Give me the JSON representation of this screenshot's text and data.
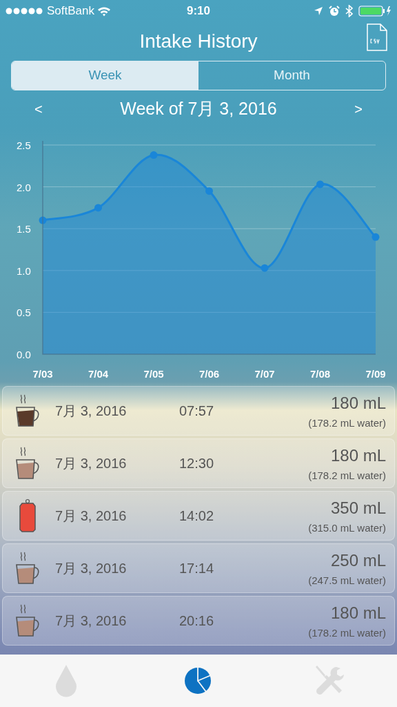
{
  "status_bar": {
    "carrier": "SoftBank",
    "time": "9:10"
  },
  "title": "Intake History",
  "segments": [
    {
      "label": "Week",
      "selected": true
    },
    {
      "label": "Month",
      "selected": false
    }
  ],
  "week_nav": {
    "prev": "<",
    "label": "Week of 7月 3, 2016",
    "next": ">"
  },
  "chart_data": {
    "type": "area",
    "categories": [
      "7/03",
      "7/04",
      "7/05",
      "7/06",
      "7/07",
      "7/08",
      "7/09"
    ],
    "grid": true,
    "series": [
      {
        "color": "#1a86d8",
        "values": [
          1.6,
          1.75,
          2.38,
          1.95,
          1.03,
          2.03,
          1.4
        ]
      }
    ],
    "ylim": [
      0,
      2.5
    ],
    "yticks": [
      {
        "value": 0,
        "label": "0.0"
      },
      {
        "value": 0.5,
        "label": "0.5"
      },
      {
        "value": 1,
        "label": "1.0"
      },
      {
        "value": 1.5,
        "label": "1.5"
      },
      {
        "value": 2,
        "label": "2.0"
      },
      {
        "value": 2.5,
        "label": "2.5"
      }
    ]
  },
  "entries": [
    {
      "kind": "cup",
      "color": "#5a3a2a",
      "date": "7月 3, 2016",
      "time": "07:57",
      "amount": "180 mL",
      "water": "(178.2 mL water)"
    },
    {
      "kind": "cup",
      "color": "#b58c7a",
      "date": "7月 3, 2016",
      "time": "12:30",
      "amount": "180 mL",
      "water": "(178.2 mL water)"
    },
    {
      "kind": "can",
      "color": "#e84a3c",
      "date": "7月 3, 2016",
      "time": "14:02",
      "amount": "350 mL",
      "water": "(315.0 mL water)"
    },
    {
      "kind": "cup",
      "color": "#b58c7a",
      "date": "7月 3, 2016",
      "time": "17:14",
      "amount": "250 mL",
      "water": "(247.5 mL water)"
    },
    {
      "kind": "cup",
      "color": "#b58c7a",
      "date": "7月 3, 2016",
      "time": "20:16",
      "amount": "180 mL",
      "water": "(178.2 mL water)"
    }
  ],
  "tab_bar": [
    {
      "kind": "drop",
      "selected": false
    },
    {
      "kind": "chart",
      "selected": true
    },
    {
      "kind": "tools",
      "selected": false
    }
  ]
}
